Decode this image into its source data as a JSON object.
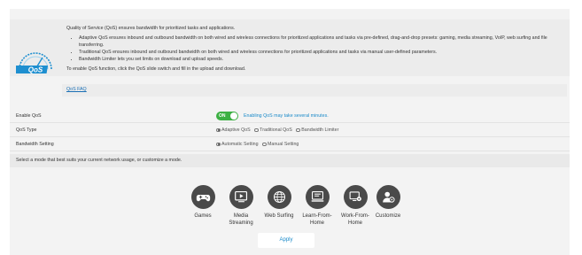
{
  "description": {
    "intro": "Quality of Service (QoS) ensures bandwidth for prioritized tasks and applications.",
    "bullets": [
      "Adaptive QoS ensures inbound and outbound bandwidth on both wired and wireless connections for prioritized applications and tasks via pre-defined, drag-and-drop presets: gaming, media streaming, VoIP, web surfing and file transferring.",
      "Traditional QoS ensures inbound and outbound bandwidth on both wired and wireless connections for prioritized applications and tasks via manual user-defined parameters.",
      "Bandwidth Limiter lets you set limits on download and upload speeds."
    ],
    "outro": "To enable QoS function, click the QoS slide switch and fill in the upload and download.",
    "logo_text": "QoS"
  },
  "faq_link": "QoS FAQ",
  "settings": {
    "enable_qos": {
      "label": "Enable QoS",
      "toggle_text": "ON",
      "hint": "Enabling QoS may take several minutes."
    },
    "qos_type": {
      "label": "QoS Type",
      "options": [
        "Adaptive QoS",
        "Traditional QoS",
        "Bandwidth Limiter"
      ],
      "selected": "Adaptive QoS"
    },
    "bandwidth": {
      "label": "Bandwidth Setting",
      "options": [
        "Automatic Setting",
        "Manual Setting"
      ],
      "selected": "Automatic Setting"
    }
  },
  "mode_prompt": "Select a mode that best suits your current network usage, or customize a mode.",
  "modes": [
    {
      "label": "Games",
      "icon": "gamepad-icon"
    },
    {
      "label": "Media Streaming",
      "icon": "media-icon"
    },
    {
      "label": "Web Surfing",
      "icon": "globe-icon"
    },
    {
      "label": "Learn-From-Home",
      "icon": "learn-icon"
    },
    {
      "label": "Work-From-Home",
      "icon": "work-icon"
    },
    {
      "label": "Customize",
      "icon": "customize-icon"
    }
  ],
  "apply_label": "Apply",
  "colors": {
    "toggle_on": "#3cb043",
    "link": "#1a6fb5",
    "hint": "#1a8ac9",
    "icon_bg": "#4a4a4a",
    "logo": "#1e8fd0"
  }
}
